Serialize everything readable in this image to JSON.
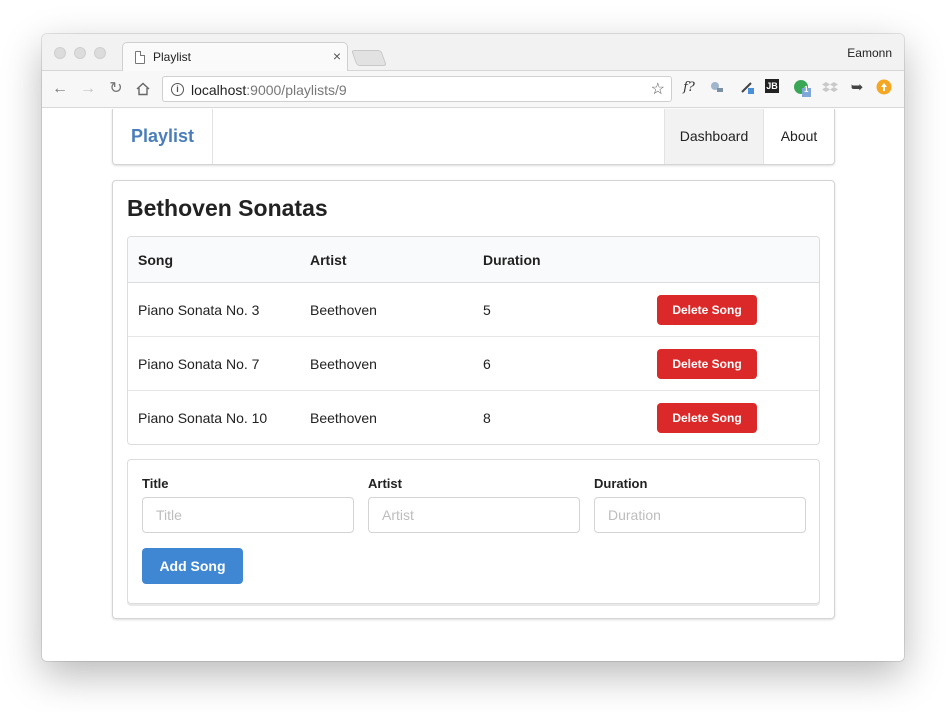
{
  "browser": {
    "tab_title": "Playlist",
    "tab_close": "×",
    "profile_name": "Eamonn",
    "url_host": "localhost",
    "url_rest": ":9000/playlists/9",
    "nav_icons": [
      "back-arrow-icon",
      "forward-arrow-icon",
      "reload-icon",
      "home-icon"
    ],
    "extension_icons": [
      "function-help-icon",
      "satellite-icon",
      "eyedropper-icon",
      "jetbrains-icon",
      "green-extension-icon",
      "dropbox-icon",
      "share-arrow-icon",
      "orange-extension-icon"
    ],
    "extension_glyphs": {
      "function_help": "f?",
      "jetbrains": "JB",
      "badge_count": "1"
    }
  },
  "navbar": {
    "brand": "Playlist",
    "items": [
      {
        "label": "Dashboard",
        "active": true
      },
      {
        "label": "About",
        "active": false
      }
    ]
  },
  "playlist": {
    "title": "Bethoven Sonatas",
    "columns": [
      "Song",
      "Artist",
      "Duration"
    ],
    "songs": [
      {
        "title": "Piano Sonata No. 3",
        "artist": "Beethoven",
        "duration": "5",
        "action": "Delete Song"
      },
      {
        "title": "Piano Sonata No. 7",
        "artist": "Beethoven",
        "duration": "6",
        "action": "Delete Song"
      },
      {
        "title": "Piano Sonata No. 10",
        "artist": "Beethoven",
        "duration": "8",
        "action": "Delete Song"
      }
    ]
  },
  "form": {
    "fields": [
      {
        "label": "Title",
        "placeholder": "Title",
        "value": ""
      },
      {
        "label": "Artist",
        "placeholder": "Artist",
        "value": ""
      },
      {
        "label": "Duration",
        "placeholder": "Duration",
        "value": ""
      }
    ],
    "submit_label": "Add Song"
  },
  "colors": {
    "brand": "#4a7ebb",
    "delete_button": "#db2828",
    "add_button": "#3f87d3"
  }
}
